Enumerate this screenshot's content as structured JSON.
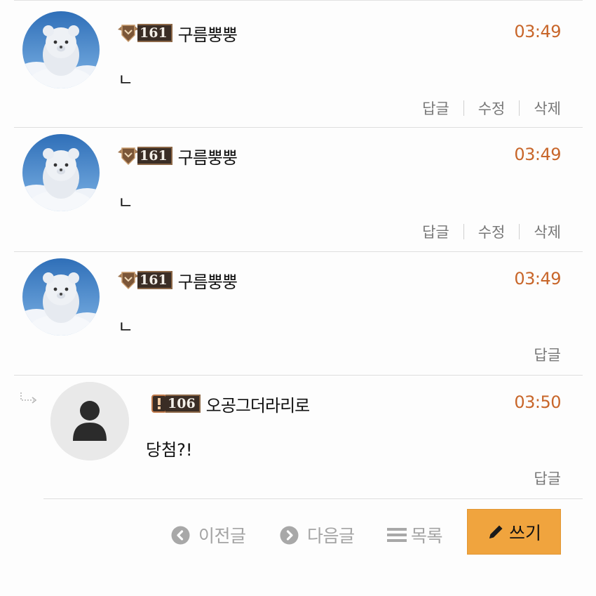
{
  "comments": [
    {
      "level": "161",
      "nickname": "구름뿡뿡",
      "time": "03:49",
      "text": "ㄴ",
      "actions": [
        "답글",
        "수정",
        "삭제"
      ]
    },
    {
      "level": "161",
      "nickname": "구름뿡뿡",
      "time": "03:49",
      "text": "ㄴ",
      "actions": [
        "답글",
        "수정",
        "삭제"
      ]
    },
    {
      "level": "161",
      "nickname": "구름뿡뿡",
      "time": "03:49",
      "text": "ㄴ",
      "actions": [
        "답글"
      ]
    },
    {
      "level": "106",
      "nickname": "오공그더라리로",
      "time": "03:50",
      "text": "당첨?!",
      "actions": [
        "답글"
      ],
      "is_reply": true
    }
  ],
  "bottom_nav": {
    "prev_label": "이전글",
    "next_label": "다음글",
    "list_label": "목록",
    "write_label": "쓰기"
  },
  "colors": {
    "time": "#c8662a",
    "write_button": "#f0a43e",
    "nav_text": "#a4a4a4",
    "action_text": "#777777"
  },
  "icons": {
    "avatar_bear": "bear-cloud-avatar-icon",
    "avatar_default": "user-silhouette-icon",
    "badge": "level-badge-icon",
    "reply_arrow": "reply-arrow-icon",
    "prev": "chevron-left-circle-icon",
    "next": "chevron-right-circle-icon",
    "list": "list-icon",
    "write": "pencil-icon"
  }
}
